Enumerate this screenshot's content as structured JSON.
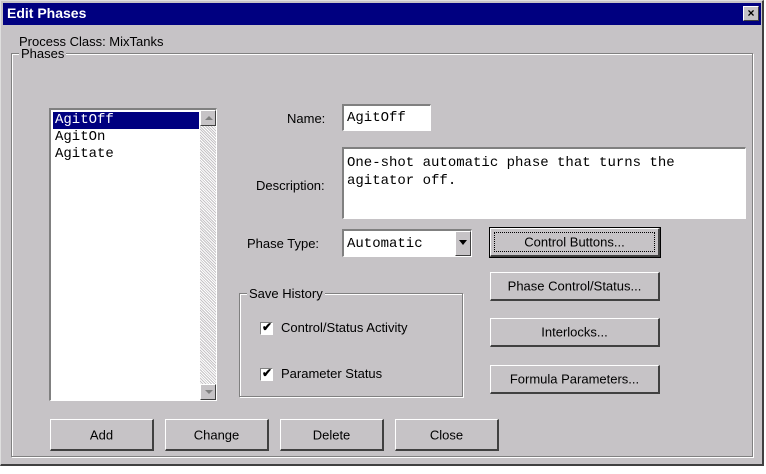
{
  "window": {
    "title": "Edit Phases",
    "close_glyph": "×"
  },
  "process_class_label": "Process Class: MixTanks",
  "phases_group": {
    "legend": "Phases",
    "items": [
      {
        "label": "AgitOff",
        "selected": true
      },
      {
        "label": "AgitOn",
        "selected": false
      },
      {
        "label": "Agitate",
        "selected": false
      }
    ]
  },
  "name": {
    "label": "Name:",
    "value": "AgitOff"
  },
  "description": {
    "label": "Description:",
    "line1": "One-shot automatic phase that turns the",
    "line2": "agitator off."
  },
  "phase_type": {
    "label": "Phase Type:",
    "value": "Automatic"
  },
  "save_history": {
    "legend": "Save History",
    "control_status_label": "Control/Status Activity",
    "control_status_checked": true,
    "parameter_status_label": "Parameter Status",
    "parameter_status_checked": true
  },
  "buttons": {
    "control_buttons": "Control Buttons...",
    "phase_control_status": "Phase Control/Status...",
    "interlocks": "Interlocks...",
    "formula_parameters": "Formula Parameters...",
    "add": "Add",
    "change": "Change",
    "delete": "Delete",
    "close": "Close"
  },
  "icons": {
    "checkmark": "✔"
  },
  "colors": {
    "title_bar": "#000080",
    "face": "#c6c3c6",
    "selection": "#000080"
  }
}
